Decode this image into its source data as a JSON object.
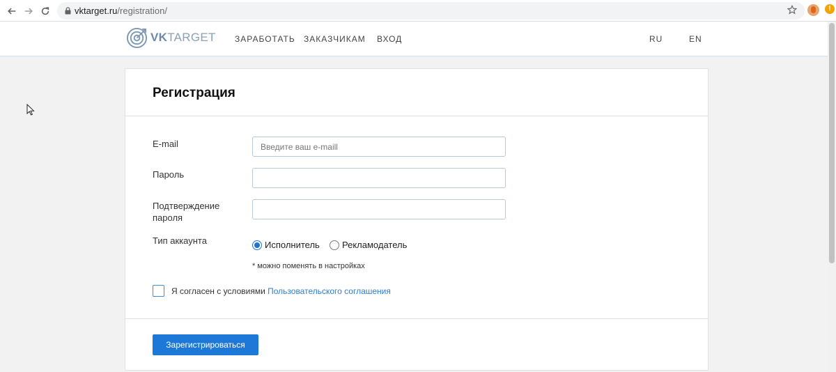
{
  "browser": {
    "url_host": "vktarget.ru",
    "url_path": "/registration/",
    "alert_badge": "!",
    "icons": [
      "back-arrow-icon",
      "forward-arrow-icon",
      "reload-icon",
      "lock-icon",
      "bookmark-star-icon",
      "profile-avatar-icon",
      "update-alert-icon"
    ]
  },
  "header": {
    "logo_strong": "VK",
    "logo_rest": "TARGET",
    "nav": {
      "earn": "ЗАРАБОТАТЬ",
      "customers": "ЗАКАЗЧИКАМ",
      "login": "ВХОД"
    },
    "langs": {
      "ru": "RU",
      "en": "EN"
    }
  },
  "form": {
    "title": "Регистрация",
    "email": {
      "label": "E-mail",
      "placeholder": "Введите ваш e-maill",
      "value": ""
    },
    "password": {
      "label": "Пароль",
      "value": ""
    },
    "password_confirm": {
      "label_line1": "Подтверждение",
      "label_line2": "пароля",
      "value": ""
    },
    "account_type": {
      "label": "Тип аккаунта",
      "options": [
        "Исполнитель",
        "Рекламодатель"
      ],
      "selected": "Исполнитель"
    },
    "hint": "* можно поменять в настройках",
    "agree": {
      "text": "Я согласен с условиями ",
      "link": "Пользовательского соглашения",
      "checked": false
    },
    "submit_label": "Зарегистрироваться"
  },
  "colors": {
    "accent": "#1e78d7",
    "link": "#2a7fd2",
    "page_bg": "#f2f2f2"
  }
}
